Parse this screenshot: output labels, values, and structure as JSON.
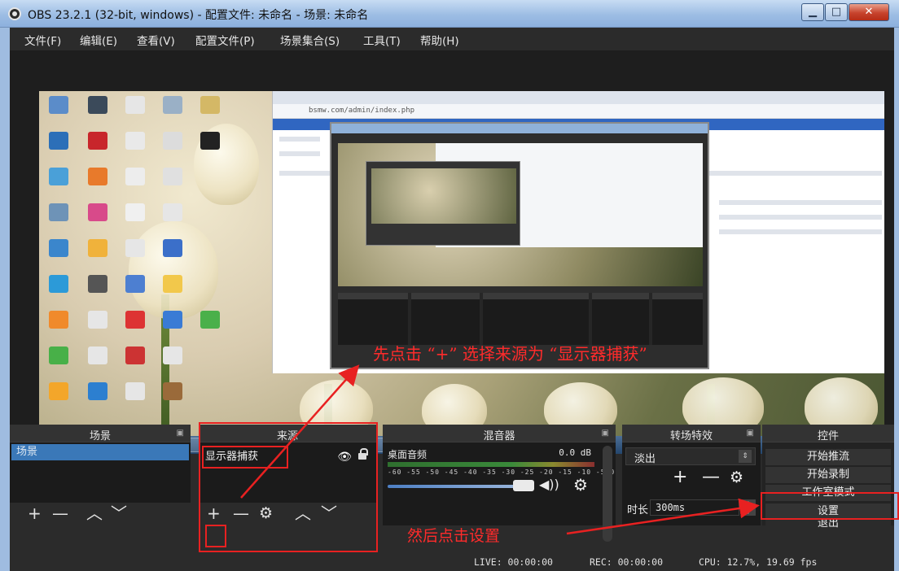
{
  "window": {
    "title": "OBS 23.2.1 (32-bit, windows) - 配置文件: 未命名 - 场景: 未命名",
    "minimize_icon": "minimize-icon",
    "maximize_icon": "maximize-icon",
    "close_icon": "close-icon"
  },
  "menu": {
    "items": [
      "文件(F)",
      "编辑(E)",
      "查看(V)",
      "配置文件(P)",
      "场景集合(S)",
      "工具(T)",
      "帮助(H)"
    ]
  },
  "preview": {
    "inner_browser_url": "bsmw.com/admin/index.php",
    "annotation": "先点击 “+” 选择来源为 “显示器捕获”"
  },
  "scenes": {
    "title": "场景",
    "items": [
      "场景"
    ]
  },
  "sources": {
    "title": "来源",
    "items": [
      {
        "label": "显示器捕获",
        "visible_icon": "eye-icon",
        "lock_icon": "lock-icon"
      }
    ]
  },
  "mixer": {
    "title": "混音器",
    "track": {
      "name": "桌面音频",
      "db": "0.0 dB",
      "scale": "-60 -55 -50 -45 -40 -35 -30 -25 -20 -15 -10 -5 0",
      "volume_level": 1.0
    }
  },
  "transitions": {
    "title": "转场特效",
    "selected": "淡出",
    "duration_label": "时长",
    "duration_value": "300ms"
  },
  "controls": {
    "title": "控件",
    "start_streaming": "开始推流",
    "start_recording": "开始录制",
    "studio_mode": "工作室模式",
    "settings": "设置",
    "exit": "退出"
  },
  "status": {
    "live": "LIVE: 00:00:00",
    "rec": "REC: 00:00:00",
    "cpu": "CPU: 12.7%, 19.69 fps"
  },
  "annotations": {
    "bottom": "然后点击设置",
    "color": "#e82121"
  },
  "colors": {
    "panel_bg": "#1b1b1b",
    "selection": "#3a78b8",
    "titlebar": "#9dbde4"
  }
}
